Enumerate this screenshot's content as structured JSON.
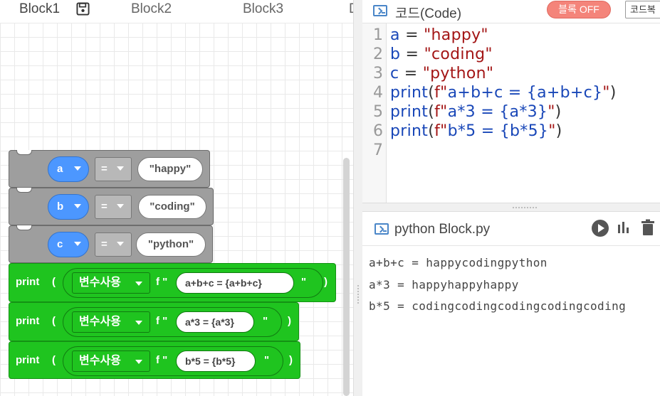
{
  "tabs": [
    {
      "label": "Block1",
      "active": true
    },
    {
      "label": "Block2",
      "active": false
    },
    {
      "label": "Block3",
      "active": false
    },
    {
      "label": "D",
      "active": false
    }
  ],
  "blocks": {
    "assignments": [
      {
        "var": "a",
        "op": "=",
        "value": "\"happy\""
      },
      {
        "var": "b",
        "op": "=",
        "value": "\"coding\""
      },
      {
        "var": "c",
        "op": "=",
        "value": "\"python\""
      }
    ],
    "prints": [
      {
        "keyword": "print",
        "paren_open": "(",
        "mode": "변수사용",
        "f": "f \"",
        "expr": "a+b+c = {a+b+c}",
        "quote_close": "\"",
        "paren_close": ")"
      },
      {
        "keyword": "print",
        "paren_open": "(",
        "mode": "변수사용",
        "f": "f \"",
        "expr": "a*3 = {a*3}",
        "quote_close": "\"",
        "paren_close": ")"
      },
      {
        "keyword": "print",
        "paren_open": "(",
        "mode": "변수사용",
        "f": "f \"",
        "expr": "b*5 = {b*5}",
        "quote_close": "\"",
        "paren_close": ")"
      }
    ]
  },
  "code_panel": {
    "title": "코드(Code)",
    "block_toggle_label": "블록 OFF",
    "copy_label": "코드복",
    "line_numbers": [
      "1",
      "2",
      "3",
      "4",
      "5",
      "6",
      "7"
    ],
    "lines": [
      "a = \"happy\"",
      "b = \"coding\"",
      "c = \"python\"",
      "print(f\"a+b+c = {a+b+c}\")",
      "print(f\"a*3 = {a*3}\")",
      "print(f\"b*5 = {b*5}\")",
      ""
    ]
  },
  "output_panel": {
    "title": "python Block.py",
    "lines": [
      "a+b+c = happycodingpython",
      "a*3 = happyhappyhappy",
      "b*5 = codingcodingcodingcodingcoding"
    ]
  },
  "colors": {
    "variable_block": "#4c97ff",
    "print_block": "#1fc41f",
    "assign_block": "#9e9e9e",
    "toggle_off": "#f4847a"
  },
  "icons": [
    "save-icon",
    "terminal-icon",
    "run-icon",
    "chart-icon",
    "trash-icon",
    "dropdown-caret-icon"
  ]
}
